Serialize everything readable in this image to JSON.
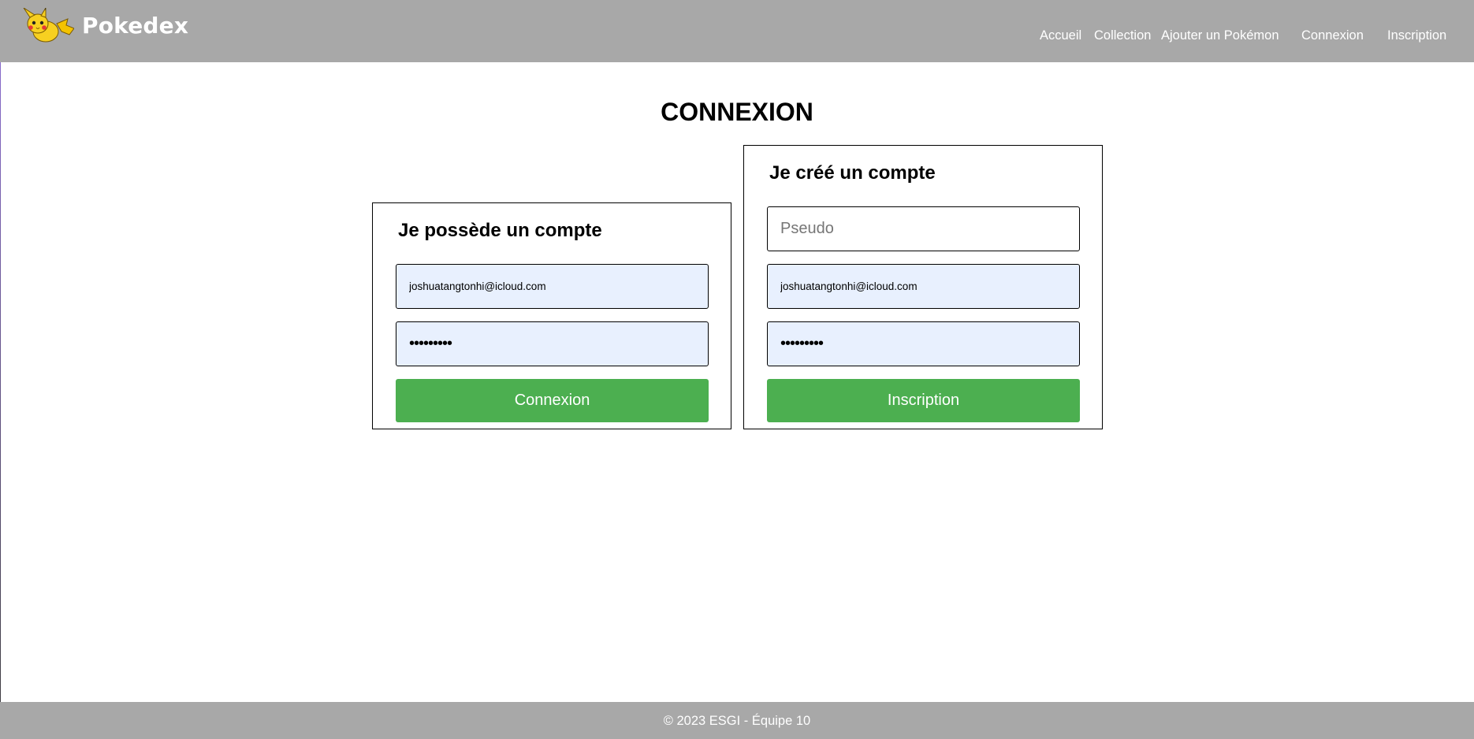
{
  "header": {
    "brand": "Pokedex",
    "logo_icon": "pikachu-icon",
    "nav": [
      {
        "label": "Accueil"
      },
      {
        "label": "Collection"
      },
      {
        "label": "Ajouter un Pokémon"
      },
      {
        "label": "Connexion"
      },
      {
        "label": "Inscription"
      }
    ]
  },
  "page": {
    "title": "CONNEXION"
  },
  "login": {
    "title": "Je possède un compte",
    "email_value": "joshuatangtonhi@icloud.com",
    "password_value": "•••••••••",
    "submit_label": "Connexion"
  },
  "signup": {
    "title": "Je créé un compte",
    "pseudo_placeholder": "Pseudo",
    "pseudo_value": "",
    "email_value": "joshuatangtonhi@icloud.com",
    "password_value": "•••••••••",
    "submit_label": "Inscription"
  },
  "footer": {
    "text": "© 2023 ESGI - Équipe 10"
  },
  "colors": {
    "header_bg": "#a8a8a8",
    "button_bg": "#4caf50",
    "autofill_bg": "#e8f0fe"
  }
}
